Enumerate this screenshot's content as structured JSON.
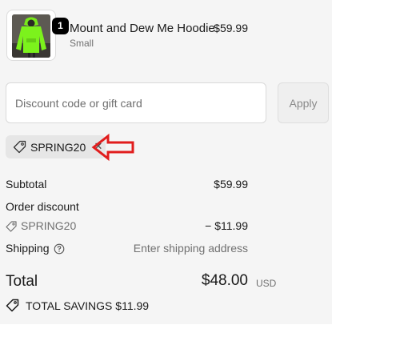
{
  "line_item": {
    "quantity": "1",
    "name": "Mount and Dew Me Hoodie",
    "variant": "Small",
    "price": "$59.99",
    "thumbnail_icon": "hoodie-product-image",
    "hoodie_color": "#7cf21c"
  },
  "discount": {
    "placeholder": "Discount code or gift card",
    "value": "",
    "apply_label": "Apply"
  },
  "applied_code": {
    "code": "SPRING20",
    "icon": "tag-icon",
    "remove_icon": "close-icon"
  },
  "annotation": {
    "icon": "red-arrow-icon",
    "color": "#e11d1d"
  },
  "summary": {
    "subtotal_label": "Subtotal",
    "subtotal_value": "$59.99",
    "order_discount_label": "Order discount",
    "discount_code": "SPRING20",
    "discount_value": "− $11.99",
    "shipping_label": "Shipping",
    "shipping_value": "Enter shipping address",
    "total_label": "Total",
    "currency": "USD",
    "total_value": "$48.00",
    "savings_text": "TOTAL SAVINGS  $11.99"
  }
}
